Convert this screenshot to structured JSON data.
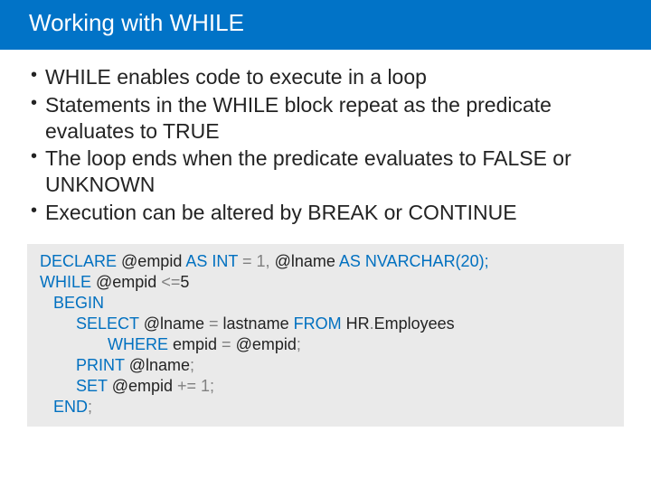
{
  "title": "Working with WHILE",
  "bullets": [
    "WHILE enables code to execute in a loop",
    "Statements in the WHILE block repeat as the predicate evaluates to TRUE",
    "The loop ends when the predicate evaluates to FALSE or UNKNOWN",
    "Execution can be altered by BREAK or CONTINUE"
  ],
  "code": {
    "l1a": "DECLARE",
    "l1b": " @empid ",
    "l1c": "AS INT",
    "l1d": " = ",
    "l1e": "1,",
    "l1f": " @lname ",
    "l1g": "AS NVARCHAR(20);",
    "l2a": "WHILE",
    "l2b": " @empid ",
    "l2c": "<=",
    "l2d": "5",
    "l3": "   BEGIN",
    "l4a": "        SELECT",
    "l4b": " @lname ",
    "l4c": "=",
    "l4d": " lastname ",
    "l4e": "FROM",
    "l4f": " HR",
    "l4g": ".",
    "l4h": "Employees",
    "l5a": "               WHERE",
    "l5b": " empid ",
    "l5c": "=",
    "l5d": " @empid",
    "l5e": ";",
    "l6a": "        PRINT",
    "l6b": " @lname",
    "l6c": ";",
    "l7a": "        SET",
    "l7b": " @empid ",
    "l7c": "+=",
    "l7d": " 1;",
    "l8a": "   END",
    "l8b": ";"
  }
}
